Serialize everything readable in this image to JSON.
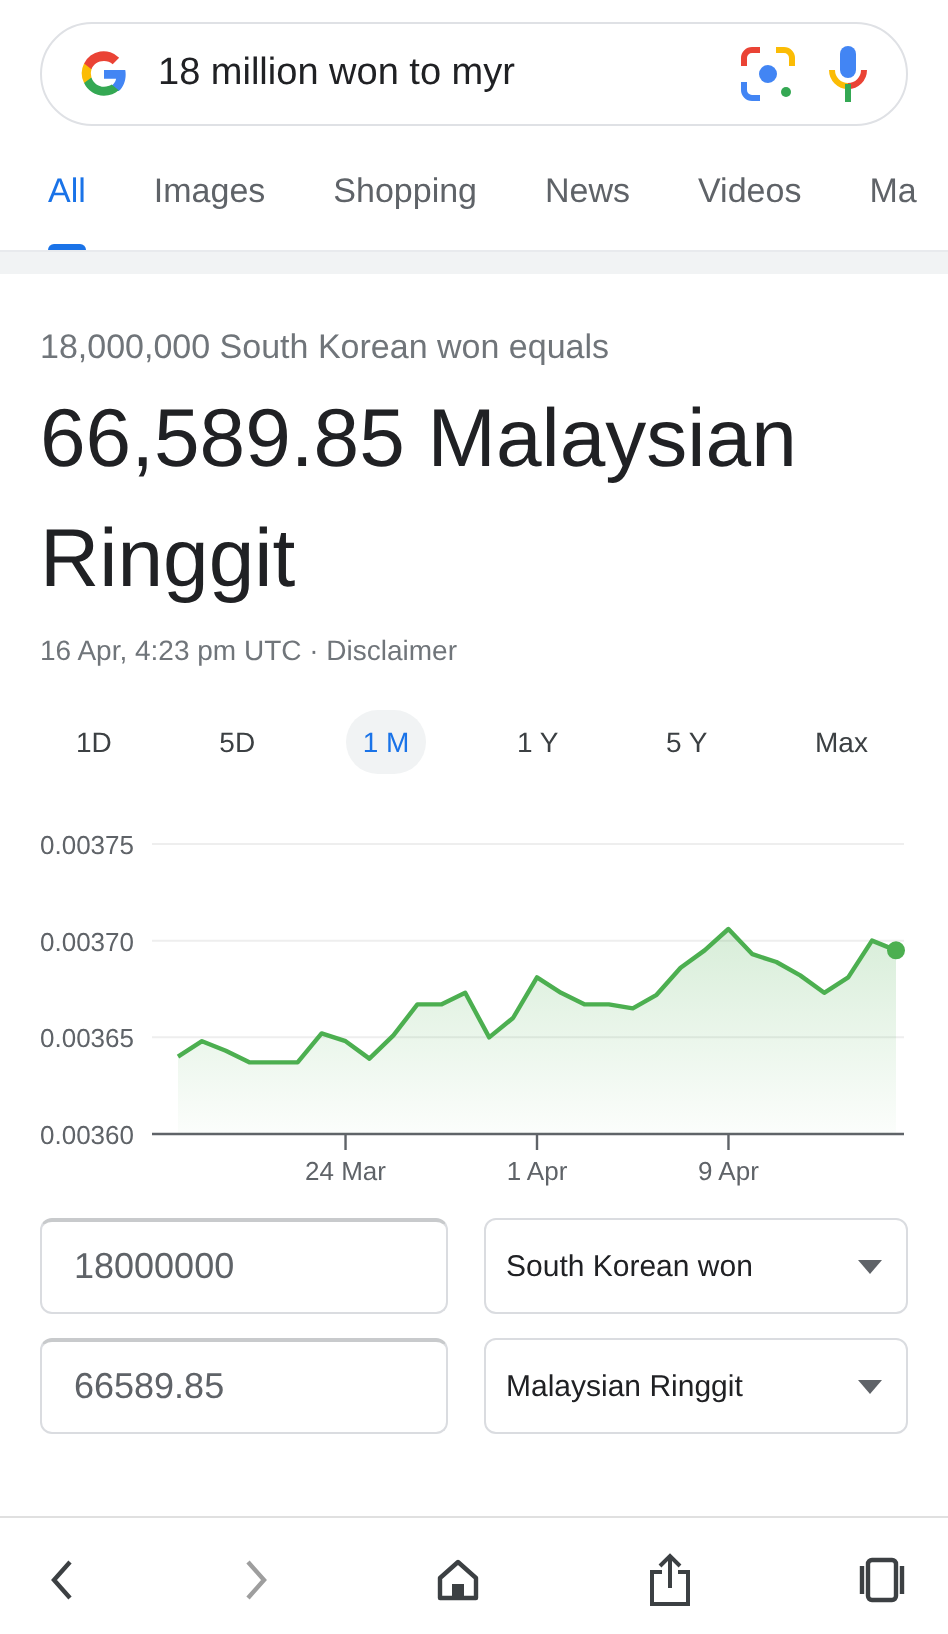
{
  "search": {
    "value": "18 million won to myr"
  },
  "tabs": [
    {
      "label": "All",
      "selected": true
    },
    {
      "label": "Images",
      "selected": false
    },
    {
      "label": "Shopping",
      "selected": false
    },
    {
      "label": "News",
      "selected": false
    },
    {
      "label": "Videos",
      "selected": false
    },
    {
      "label": "Ma",
      "selected": false
    }
  ],
  "converter": {
    "subtitle": "18,000,000 South Korean won equals",
    "result": "66,589.85 Malaysian Ringgit",
    "timestamp": "16 Apr, 4:23 pm UTC · ",
    "disclaimer": "Disclaimer",
    "ranges": [
      {
        "label": "1D",
        "selected": false
      },
      {
        "label": "5D",
        "selected": false
      },
      {
        "label": "1 M",
        "selected": true
      },
      {
        "label": "1 Y",
        "selected": false
      },
      {
        "label": "5 Y",
        "selected": false
      },
      {
        "label": "Max",
        "selected": false
      }
    ],
    "chart_data": {
      "type": "area",
      "categories": [
        null,
        null,
        null,
        null,
        null,
        null,
        null,
        "24 Mar",
        null,
        null,
        null,
        null,
        null,
        null,
        null,
        "1 Apr",
        null,
        null,
        null,
        null,
        null,
        null,
        null,
        "9 Apr",
        null,
        null,
        null,
        null,
        null,
        null,
        null
      ],
      "series": [
        {
          "color": "#4caf50",
          "values": [
            0.00364,
            0.003648,
            0.003643,
            0.003637,
            0.003637,
            0.003637,
            0.003652,
            0.003648,
            0.003639,
            0.003651,
            0.003667,
            0.003667,
            0.003673,
            0.00365,
            0.00366,
            0.003681,
            0.003673,
            0.003667,
            0.003667,
            0.003665,
            0.003672,
            0.003686,
            0.003695,
            0.003706,
            0.003693,
            0.003689,
            0.003682,
            0.003673,
            0.003681,
            0.0037,
            0.003695
          ]
        }
      ],
      "ylim": [
        0.0036,
        0.00375
      ],
      "yticks": [
        {
          "value": 0.0036,
          "label": "0.00360"
        },
        {
          "value": 0.00365,
          "label": "0.00365"
        },
        {
          "value": 0.0037,
          "label": "0.00370"
        },
        {
          "value": 0.00375,
          "label": "0.00375"
        }
      ]
    },
    "rows": [
      {
        "amount": "18000000",
        "currency": "South Korean won"
      },
      {
        "amount": "66589.85",
        "currency": "Malaysian Ringgit"
      }
    ]
  },
  "toolbar": [
    {
      "kind": "back",
      "disabled": false
    },
    {
      "kind": "forward",
      "disabled": true
    },
    {
      "kind": "home",
      "disabled": false
    },
    {
      "kind": "share",
      "disabled": false
    },
    {
      "kind": "tabs",
      "disabled": false
    }
  ]
}
